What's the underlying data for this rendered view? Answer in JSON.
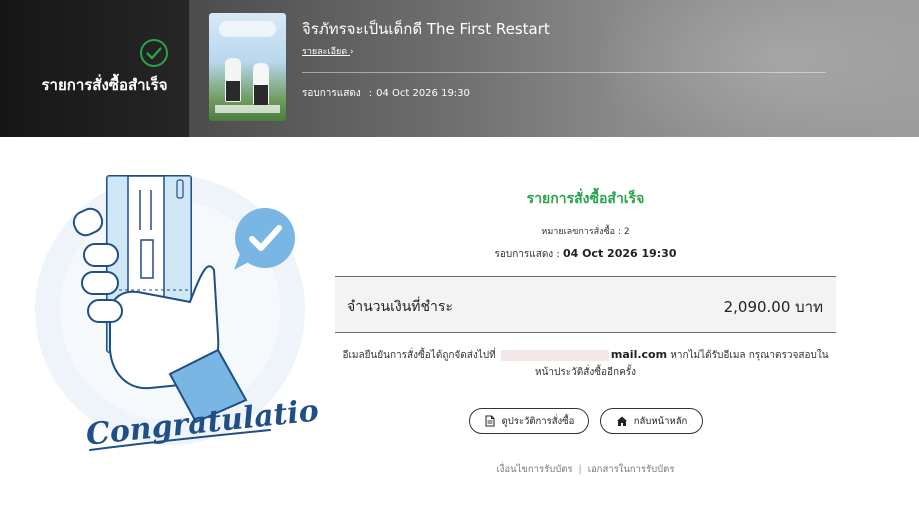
{
  "header": {
    "status_label": "รายการสั่งซื้อสำเร็จ",
    "event_title": "จิรภัทรจะเป็นเด็กดี The First Restart",
    "detail_link": "รายละเอียด",
    "detail_chevron": "›",
    "show_label": "รอบการแสดง",
    "show_sep": ":",
    "show_value": "04 Oct 2026 19:30"
  },
  "main": {
    "success_title": "รายการสั่งซื้อสำเร็จ",
    "order_label": "หมายเลขการสั่งซื้อ :",
    "order_value": "2",
    "show_label": "รอบการแสดง :",
    "show_value": "04 Oct 2026 19:30",
    "amount_label": "จำนวนเงินที่ชำระ",
    "amount_value": "2,090.00 บาท",
    "email_prefix": "อีเมลยืนยันการสั่งซื้อได้ถูกจัดส่งไปที่",
    "email_domain": "mail.com",
    "email_suffix": "หากไม่ได้รับอีเมล กรุณาตรวจสอบในหน้าประวัติสั่งซื้ออีกครั้ง",
    "btn_history": "ดูประวัติการสั่งซื้อ",
    "btn_home": "กลับหน้าหลัก",
    "footer_terms": "เงื่อนไขการรับบัตร",
    "footer_sep": "|",
    "footer_docs": "เอกสารในการรับบัตร"
  },
  "illustration": {
    "caption": "Congratulations"
  },
  "colors": {
    "accent_green": "#2aa44b",
    "header_dark": "#1c1c1c",
    "ticket_blue": "#8fc8ee",
    "navy": "#1f4f86",
    "bubble_blue": "#7ab6e4"
  },
  "icons": [
    "check-circle-icon",
    "chevron-right-icon",
    "document-icon",
    "home-icon"
  ]
}
